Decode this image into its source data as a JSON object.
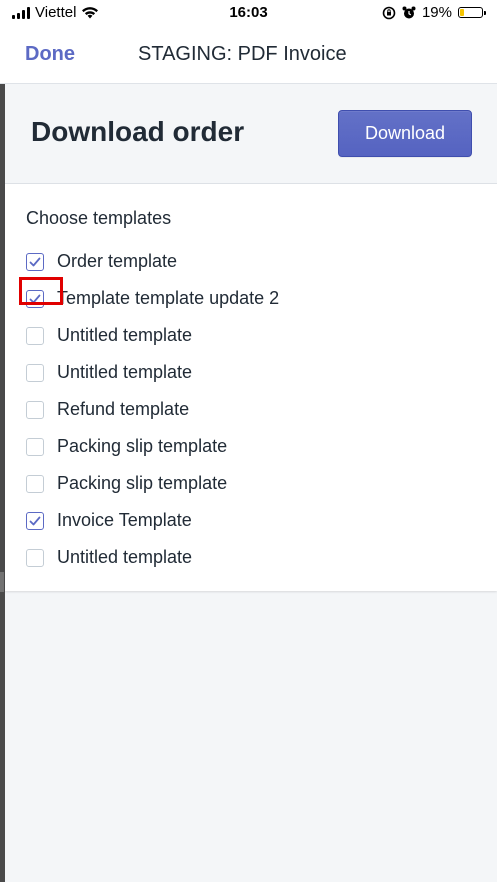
{
  "status_bar": {
    "carrier": "Viettel",
    "time": "16:03",
    "battery_percent": "19%",
    "battery_level": 0.19
  },
  "nav": {
    "done_label": "Done",
    "title": "STAGING: PDF Invoice"
  },
  "header": {
    "title": "Download order",
    "download_label": "Download"
  },
  "templates": {
    "section_label": "Choose templates",
    "items": [
      {
        "label": "Order template",
        "checked": true
      },
      {
        "label": "Template template update 2",
        "checked": true
      },
      {
        "label": "Untitled template",
        "checked": false
      },
      {
        "label": "Untitled template",
        "checked": false
      },
      {
        "label": "Refund template",
        "checked": false
      },
      {
        "label": "Packing slip template",
        "checked": false
      },
      {
        "label": "Packing slip template",
        "checked": false
      },
      {
        "label": "Invoice Template",
        "checked": true
      },
      {
        "label": "Untitled template",
        "checked": false
      }
    ]
  },
  "colors": {
    "accent": "#5c6ac4",
    "highlight": "#e00000",
    "battery": "#f5c400"
  }
}
